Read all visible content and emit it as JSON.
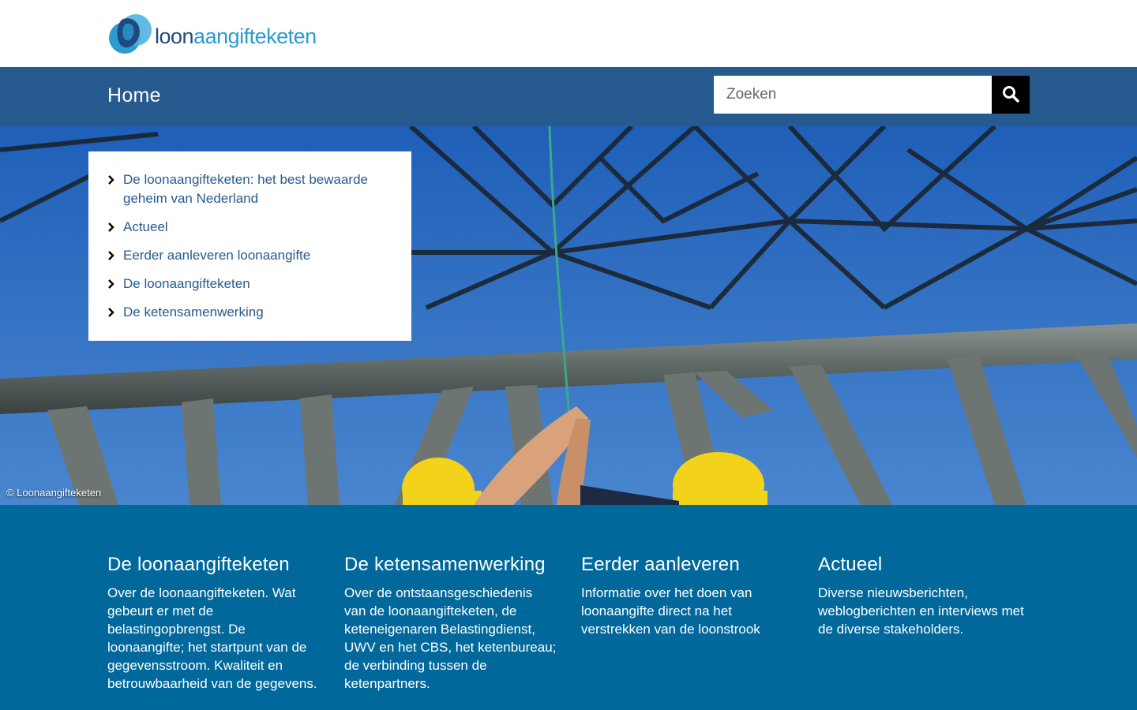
{
  "header": {
    "logo_text_part1": "loon",
    "logo_text_part2": "aangifteketen"
  },
  "nav": {
    "home_label": "Home",
    "search_placeholder": "Zoeken",
    "search_icon": "search-icon"
  },
  "hero": {
    "credit": "© Loonaangifteketen",
    "menu": [
      {
        "label": "De loonaangifteketen: het best bewaarde geheim van Nederland"
      },
      {
        "label": "Actueel"
      },
      {
        "label": "Eerder aanleveren loonaangifte"
      },
      {
        "label": "De loonaangifteketen"
      },
      {
        "label": "De ketensamenwerking"
      }
    ]
  },
  "blocks": [
    {
      "title": "De loonaangifteketen",
      "text": "Over de loonaangifteketen. Wat gebeurt er met de belastingopbrengst. De loonaangifte; het startpunt van de gegevensstroom. Kwaliteit en betrouwbaarheid van de gegevens."
    },
    {
      "title": "De ketensamenwerking",
      "text": "Over de ontstaansgeschiedenis van de loonaangifteketen, de keteneigenaren Belastingdienst, UWV en het CBS, het ketenbureau; de verbinding tussen de ketenpartners."
    },
    {
      "title": "Eerder aanleveren",
      "text": "Informatie over het doen van loonaangifte direct na het verstrekken van de loonstrook"
    },
    {
      "title": "Actueel",
      "text": "Diverse nieuwsberichten, weblogberichten en interviews met de diverse stakeholders."
    }
  ],
  "colors": {
    "navbar": "#275a8e",
    "blocks_bg": "#01689b",
    "link": "#275a8e",
    "logo_dark": "#1e4b7e",
    "logo_light": "#2b9bd0"
  }
}
